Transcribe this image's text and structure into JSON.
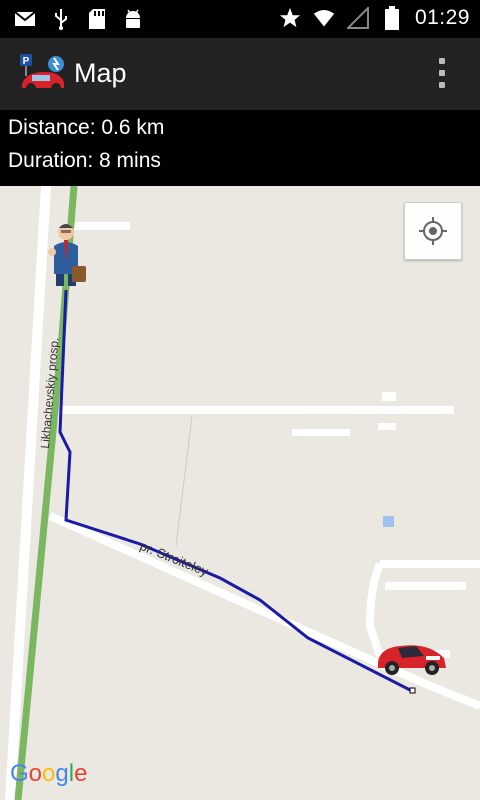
{
  "status_bar": {
    "time": "01:29",
    "left_icons": [
      "gmail-icon",
      "usb-icon",
      "sd-card-icon",
      "android-icon"
    ],
    "right_icons": [
      "star-icon",
      "wifi-icon",
      "signal-icon",
      "battery-icon"
    ]
  },
  "action_bar": {
    "title": "Map",
    "app_icon": "parking-car-icon",
    "menu_icon": "overflow-menu-icon"
  },
  "info": {
    "distance": "Distance: 0.6 km",
    "duration": "Duration: 8 mins"
  },
  "map": {
    "streets": [
      "Likhachevskiy prosp.",
      "pr. Stroiteley"
    ],
    "attribution": "Google",
    "colors": {
      "route": "#1a1aa6",
      "highway": "#7bb661",
      "background": "#ebe8e2"
    }
  }
}
